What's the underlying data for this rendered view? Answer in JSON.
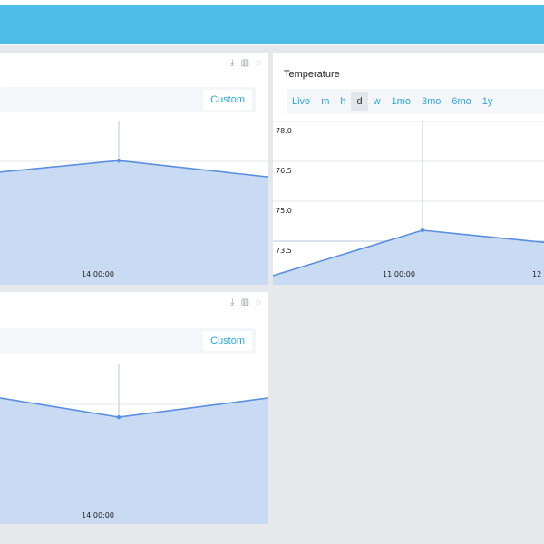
{
  "colors": {
    "header": "#4dbde8",
    "accent": "#2aa7e0",
    "series_line": "#5b8fe0",
    "series_fill": "#c9dbf3",
    "background": "#e6e8eb"
  },
  "icons": [
    "download-icon",
    "bar-chart-icon",
    "info-icon"
  ],
  "panels": {
    "top_left": {
      "custom_label": "Custom",
      "x_tick": "14:00:00"
    },
    "temperature": {
      "title": "Temperature",
      "ranges": [
        "Live",
        "m",
        "h",
        "d",
        "w",
        "1mo",
        "3mo",
        "6mo",
        "1y"
      ],
      "active_range": "d",
      "y_ticks": [
        "78.0",
        "76.5",
        "75.0",
        "73.5"
      ],
      "x_ticks": [
        "11:00:00",
        "12"
      ]
    },
    "bottom_left": {
      "custom_label": "Custom",
      "x_tick": "14:00:00"
    }
  },
  "chart_data": [
    {
      "type": "area",
      "panel": "top_left",
      "x": [
        "",
        "14:00:00",
        ""
      ],
      "values": [
        0.69,
        0.76,
        0.66
      ],
      "ylim": [
        0,
        1
      ]
    },
    {
      "type": "area",
      "panel": "temperature",
      "title": "Temperature",
      "x": [
        "",
        "11:00:00",
        "12"
      ],
      "values": [
        73.2,
        74.7,
        74.3
      ],
      "ylim": [
        72.9,
        78.3
      ],
      "y_ticks": [
        78.0,
        76.5,
        75.0,
        73.5
      ]
    },
    {
      "type": "area",
      "panel": "bottom_left",
      "x": [
        "",
        "14:00:00",
        ""
      ],
      "values": [
        0.79,
        0.67,
        0.79
      ],
      "ylim": [
        0,
        1
      ]
    }
  ]
}
